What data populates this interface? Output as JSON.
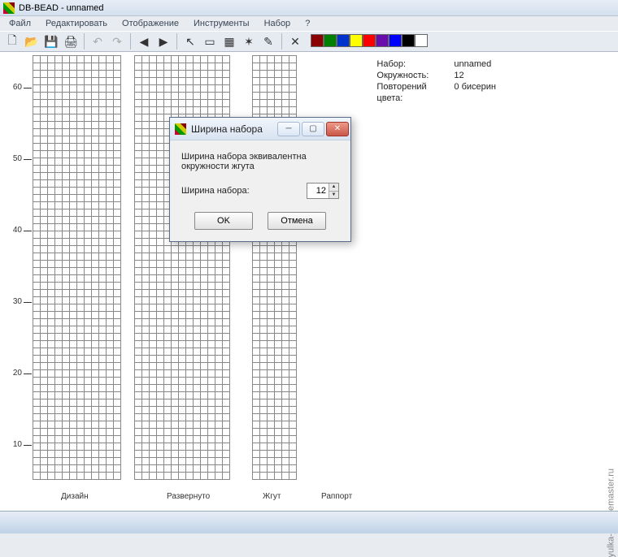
{
  "title": "DB-BEAD  -  unnamed",
  "menu": [
    "Файл",
    "Редактировать",
    "Отображение",
    "Инструменты",
    "Набор",
    "?"
  ],
  "toolbar_glyphs": {
    "new": "🗋",
    "open": "📂",
    "save": "💾",
    "print": "🖨",
    "undo": "↶",
    "redo": "↷",
    "left": "◀",
    "right": "▶",
    "pointer": "↖",
    "marquee": "▭",
    "fill": "▦",
    "wand": "✶",
    "pipette": "✎",
    "x": "✕"
  },
  "palette": [
    "#8b0000",
    "#008000",
    "#0033cc",
    "#ffff00",
    "#ff0000",
    "#6a0dad",
    "#0000ff",
    "#000000",
    "#ffffff"
  ],
  "ruler": [
    "60",
    "50",
    "40",
    "30",
    "20",
    "10"
  ],
  "columns": {
    "design": "Дизайн",
    "expanded": "Развернуто",
    "rope": "Жгут",
    "rapport": "Раппорт"
  },
  "info": {
    "set_label": "Набор:",
    "set_value": "unnamed",
    "circ_label": "Окружность:",
    "circ_value": "12",
    "rep_label": "Повторений цвета:",
    "rep_value": "0 бисерин"
  },
  "dialog": {
    "title": "Ширина набора",
    "desc": "Ширина набора эквивалентна окружности жгута",
    "label": "Ширина набора:",
    "value": "12",
    "ok": "OK",
    "cancel": "Отмена"
  },
  "watermark": "yulka-jao.livemaster.ru"
}
